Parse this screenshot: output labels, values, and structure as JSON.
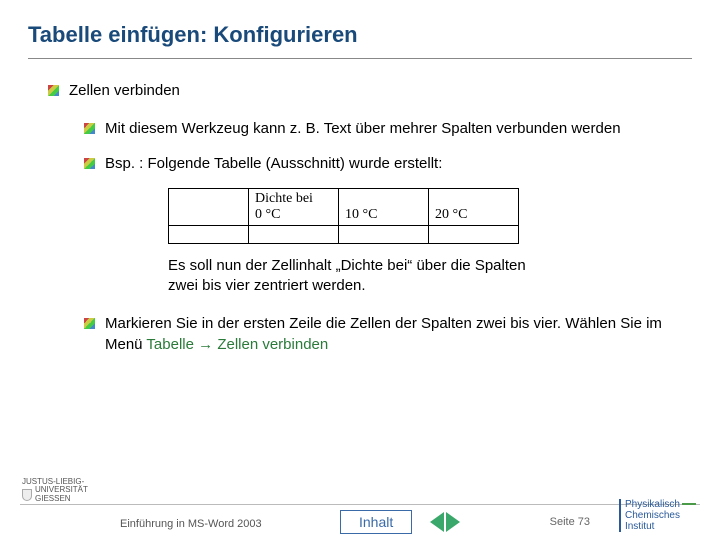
{
  "title": "Tabelle einfügen: Konfigurieren",
  "bullets": {
    "b1": "Zellen verbinden",
    "b2": "Mit diesem Werkzeug kann z. B. Text über mehrer Spalten verbunden werden",
    "b3": "Bsp. : Folgende Tabelle (Ausschnitt) wurde erstellt:",
    "b4_prefix": "Markieren Sie in der ersten Zeile die Zellen der Spalten zwei bis vier. Wählen Sie im Menü ",
    "b4_menu1": "Tabelle",
    "b4_arrow": " → ",
    "b4_menu2": "Zellen verbinden"
  },
  "table": {
    "r1c2a": "Dichte bei",
    "r1c2b": "0 °C",
    "r1c3": "10 °C",
    "r1c4": "20 °C"
  },
  "note": "Es soll nun der Zellinhalt „Dichte bei“ über die Spalten zwei bis vier zentriert werden.",
  "footer": {
    "uni1": "JUSTUS-LIEBIG-",
    "uni2": "UNIVERSITÄT",
    "uni3": "GIESSEN",
    "lecture": "Einführung in MS-Word 2003",
    "inhalt": "Inhalt",
    "page": "Seite 73",
    "inst1": "Physikalisch",
    "inst2": "Chemisches",
    "inst3": "Institut"
  }
}
